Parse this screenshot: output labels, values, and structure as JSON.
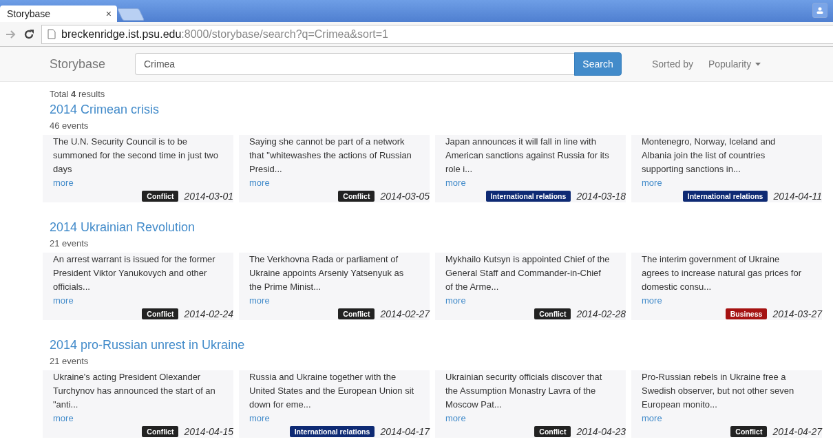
{
  "browser": {
    "tab_title": "Storybase",
    "tab_close": "×",
    "url_host": "breckenridge.ist.psu.edu",
    "url_rest": ":8000/storybase/search?q=Crimea&sort=1"
  },
  "navbar": {
    "brand": "Storybase",
    "search_value": "Crimea",
    "search_button": "Search",
    "sort_label": "Sorted by",
    "sort_value": "Popularity"
  },
  "summary": {
    "prefix": "Total",
    "count": "4",
    "suffix": "results"
  },
  "stories": [
    {
      "title": "2014 Crimean crisis",
      "count": "46 events",
      "events": [
        {
          "text": "The U.N. Security Council is to be summoned for the second time in just two days",
          "more": "more",
          "tag": "Conflict",
          "color": "#222222",
          "date": "2014-03-01"
        },
        {
          "text": "Saying she cannot be part of a network that \"whitewashes the actions of Russian Presid...",
          "more": "more",
          "tag": "Conflict",
          "color": "#222222",
          "date": "2014-03-05"
        },
        {
          "text": "Japan announces it will fall in line with American sanctions against Russia for its role i...",
          "more": "more",
          "tag": "International relations",
          "color": "#0e2a74",
          "date": "2014-03-18"
        },
        {
          "text": "Montenegro, Norway, Iceland and Albania join the list of countries supporting sanctions in...",
          "more": "more",
          "tag": "International relations",
          "color": "#0e2a74",
          "date": "2014-04-11"
        }
      ]
    },
    {
      "title": "2014 Ukrainian Revolution",
      "count": "21 events",
      "events": [
        {
          "text": "An arrest warrant is issued for the former President Viktor Yanukovych and other officials...",
          "more": "more",
          "tag": "Conflict",
          "color": "#222222",
          "date": "2014-02-24"
        },
        {
          "text": "The Verkhovna Rada or parliament of Ukraine appoints Arseniy Yatsenyuk as the Prime Minist...",
          "more": "more",
          "tag": "Conflict",
          "color": "#222222",
          "date": "2014-02-27"
        },
        {
          "text": "Mykhailo Kutsyn is appointed Chief of the General Staff and Commander-in-Chief of the Arme...",
          "more": "more",
          "tag": "Conflict",
          "color": "#222222",
          "date": "2014-02-28"
        },
        {
          "text": "The interim government of Ukraine agrees to increase natural gas prices for domestic consu...",
          "more": "more",
          "tag": "Business",
          "color": "#a51212",
          "date": "2014-03-27"
        }
      ]
    },
    {
      "title": "2014 pro-Russian unrest in Ukraine",
      "count": "21 events",
      "events": [
        {
          "text": "Ukraine's acting President Olexander Turchynov has announced the start of an \"anti...",
          "more": "more",
          "tag": "Conflict",
          "color": "#222222",
          "date": "2014-04-15"
        },
        {
          "text": "Russia and Ukraine together with the United States and the European Union sit down for eme...",
          "more": "more",
          "tag": "International relations",
          "color": "#0e2a74",
          "date": "2014-04-17"
        },
        {
          "text": "Ukrainian security officials discover that the Assumption Monastry Lavra of the Moscow Pat...",
          "more": "more",
          "tag": "Conflict",
          "color": "#222222",
          "date": "2014-04-23"
        },
        {
          "text": "Pro-Russian rebels in Ukraine free a Swedish observer, but not other seven European monito...",
          "more": "more",
          "tag": "Conflict",
          "color": "#222222",
          "date": "2014-04-27"
        }
      ]
    }
  ]
}
